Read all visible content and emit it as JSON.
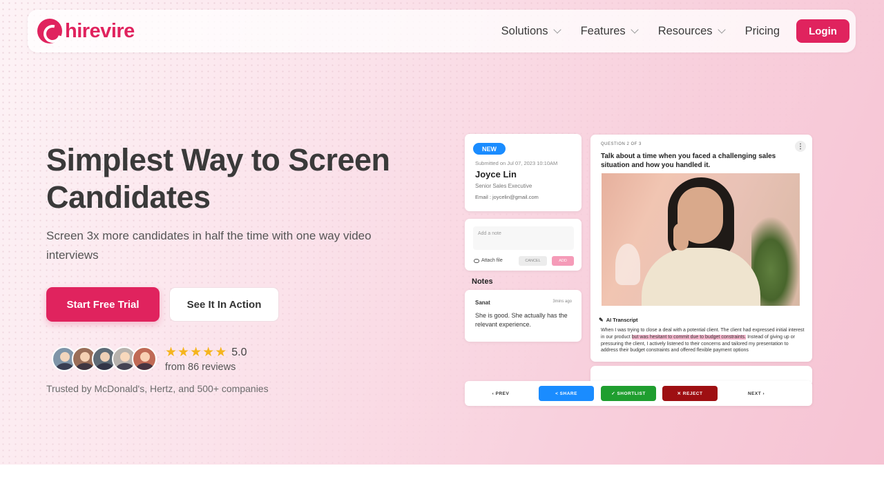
{
  "brand": {
    "name": "hirevire",
    "accent": "#e0235e"
  },
  "nav": {
    "items": [
      {
        "label": "Solutions",
        "has_dropdown": true
      },
      {
        "label": "Features",
        "has_dropdown": true
      },
      {
        "label": "Resources",
        "has_dropdown": true
      },
      {
        "label": "Pricing",
        "has_dropdown": false
      }
    ],
    "login_label": "Login"
  },
  "hero": {
    "headline": "Simplest Way to Screen Candidates",
    "subline": "Screen 3x more candidates in half the time with one way video interviews",
    "primary_cta": "Start Free Trial",
    "secondary_cta": "See It In Action",
    "rating": {
      "stars": 5,
      "value": "5.0",
      "reviews": "from 86 reviews"
    },
    "trusted": "Trusted by McDonald's, Hertz, and 500+ companies"
  },
  "mockup": {
    "candidate": {
      "badge": "NEW",
      "submitted": "Submitted on Jul 07, 2023 10:10AM",
      "name": "Joyce Lin",
      "role": "Senior Sales Executive",
      "email": "Email    : joycelin@gmail.com"
    },
    "note_form": {
      "placeholder": "Add a note",
      "attach": "Attach file",
      "cancel": "CANCEL",
      "add": "ADD"
    },
    "notes": {
      "heading": "Notes",
      "author": "Sanat",
      "time": "3mins ago",
      "text": "She is good. She actually has the relevant experience."
    },
    "question": {
      "count": "QUESTION 2 OF 3",
      "text": "Talk about a time when you faced a challenging sales situation and how you handled it.",
      "ai_label": "AI Transcript",
      "transcript_before": "When I was trying to close a deal with a potential client. The client had expressed initial interest in our product ",
      "transcript_highlight": "but was hesitant to commit due to budget constraints.",
      "transcript_after": " Instead of giving up or pressuring the client, I actively listened to their concerns and tailored my presentation to address their budget constraints and offered flexible payment options"
    },
    "actions": {
      "prev": "‹ PREV",
      "share": "< SHARE",
      "shortlist": "✓ SHORTLIST",
      "reject": "✕ REJECT",
      "next": "NEXT ›"
    }
  }
}
